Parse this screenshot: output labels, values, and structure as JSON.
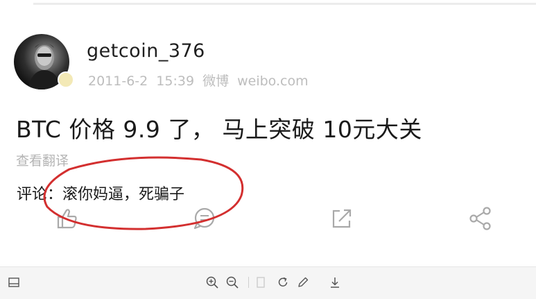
{
  "post": {
    "username": "getcoin_376",
    "meta": "2011-6-2 15:39  微博 weibo.com",
    "text": "BTC 价格 9.9 了， 马上突破 10元大关",
    "translate_label": "查看翻译"
  },
  "comment": {
    "text": "评论：滚你妈逼，死骗子"
  },
  "actions": [
    {
      "name": "like",
      "icon": "thumbs-up-icon"
    },
    {
      "name": "comment",
      "icon": "comment-icon"
    },
    {
      "name": "repost",
      "icon": "repost-icon"
    },
    {
      "name": "share",
      "icon": "share-icon"
    }
  ],
  "toolbar": {
    "icons": [
      "panel-toggle-icon",
      "zoom-in-icon",
      "zoom-out-icon",
      "fit-icon",
      "rotate-icon",
      "edit-icon",
      "download-icon"
    ]
  },
  "colors": {
    "circle": "#d32f2f",
    "action_icon": "#a9a9a9",
    "toolbar_bg": "#f5f5f5"
  }
}
